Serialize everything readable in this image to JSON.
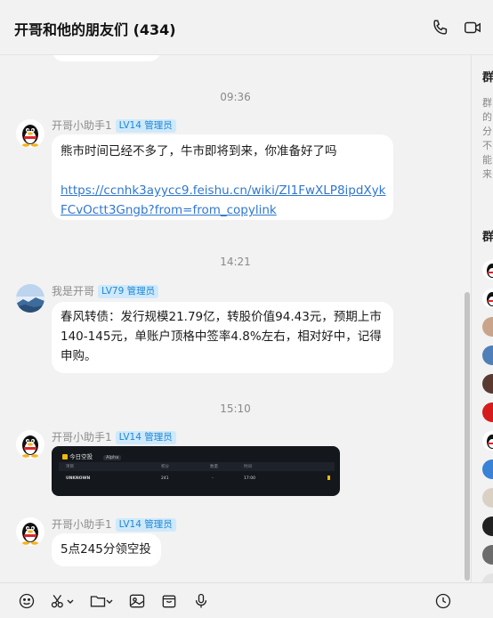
{
  "header": {
    "title": "开哥和他的朋友们 (434)",
    "call_icon": "phone-icon",
    "video_icon": "video-icon"
  },
  "messages": [
    {
      "time": "09:36",
      "sender": "开哥小助手1",
      "badge": "LV14 管理员",
      "text": "熊市时间已经不多了，牛市即将到来，你准备好了吗",
      "link_line1": "https://ccnhk3ayycc9.feishu.cn/wiki/ZI1FwXLP8ipdXyk",
      "link_line2": "FCvOctt3Gngb?from=from_copylink"
    },
    {
      "time": "14:21",
      "sender": "我是开哥",
      "badge": "LV79 管理员",
      "text": "春风转债：发行规模21.79亿，转股价值94.43元，预期上市140-145元，单账户顶格中签率4.8%左右，相对好中，记得申购。"
    },
    {
      "time": "15:10",
      "sender": "开哥小助手1",
      "badge": "LV14 管理员",
      "image": {
        "title": "今日空投",
        "tag": "Alpha",
        "cols": [
          "项目",
          "积分",
          "数量",
          "时间"
        ],
        "row": [
          "UNKNOWN",
          "241",
          "-",
          "17:00"
        ]
      }
    },
    {
      "sender": "开哥小助手1",
      "badge": "LV14 管理员",
      "text": "5点245分领空投"
    }
  ],
  "side": {
    "title1": "群",
    "text": "群的分不能来",
    "title2": "群"
  },
  "toolbar": {
    "icons": [
      "emoji-icon",
      "scissors-icon",
      "folder-icon",
      "image-icon",
      "box-icon",
      "mic-icon",
      "history-icon"
    ]
  }
}
